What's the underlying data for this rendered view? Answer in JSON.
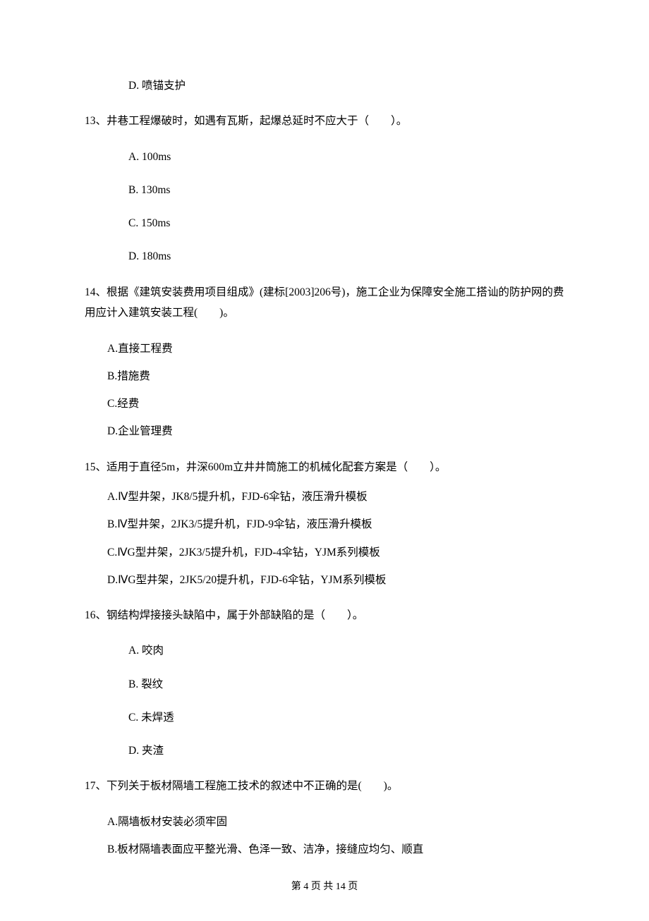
{
  "q12_optD": "D.  喷锚支护",
  "q13": {
    "stem": "13、井巷工程爆破时，如遇有瓦斯，起爆总延时不应大于（　　）。",
    "A": "A.  100ms",
    "B": "B.  130ms",
    "C": "C.  150ms",
    "D": "D.  180ms"
  },
  "q14": {
    "stem": "14、根据《建筑安装费用项目组成》(建标[2003]206号)，施工企业为保障安全施工搭讪的防护网的费用应计入建筑安装工程(　　)。",
    "A": "A.直接工程费",
    "B": "B.措施费",
    "C": "C.经费",
    "D": "D.企业管理费"
  },
  "q15": {
    "stem": "15、适用于直径5m，井深600m立井井筒施工的机械化配套方案是（　　）。",
    "A": "A.Ⅳ型井架，JK8/5提升机，FJD‐6伞钻，液压滑升模板",
    "B": "B.Ⅳ型井架，2JK3/5提升机，FJD‐9伞钻，液压滑升模板",
    "C": "C.ⅣG型井架，2JK3/5提升机，FJD‐4伞钻，YJM系列模板",
    "D": "D.ⅣG型井架，2JK5/20提升机，FJD‐6伞钻，YJM系列模板"
  },
  "q16": {
    "stem": "16、钢结构焊接接头缺陷中，属于外部缺陷的是（　　）。",
    "A": "A.  咬肉",
    "B": "B.  裂纹",
    "C": "C.  未焊透",
    "D": "D.  夹渣"
  },
  "q17": {
    "stem": "17、下列关于板材隔墙工程施工技术的叙述中不正确的是(　　)。",
    "A": "A.隔墙板材安装必须牢固",
    "B": "B.板材隔墙表面应平整光滑、色泽一致、洁净，接缝应均匀、顺直"
  },
  "footer": "第 4 页 共 14 页"
}
